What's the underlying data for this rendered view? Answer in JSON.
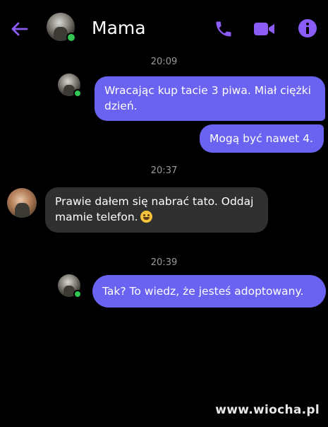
{
  "header": {
    "contact_name": "Mama",
    "icons": [
      "back-arrow-icon",
      "phone-icon",
      "video-camera-icon",
      "info-icon"
    ],
    "accent_color": "#8b5cf6",
    "online_color": "#31c554"
  },
  "messages": [
    {
      "type": "timestamp",
      "text": "20:09"
    },
    {
      "type": "outgoing",
      "lines": [
        "Wracając kup tacie 3 piwa. Miał ciężki",
        "dzień."
      ]
    },
    {
      "type": "outgoing",
      "text": "Mogą być nawet 4."
    },
    {
      "type": "timestamp",
      "text": "20:37"
    },
    {
      "type": "incoming",
      "lines": [
        "Prawie dałem się nabrać tato. Oddaj",
        "mamie telefon."
      ],
      "emoji": "smiling-face-with-sweat-emoji"
    },
    {
      "type": "timestamp",
      "text": "20:39"
    },
    {
      "type": "outgoing",
      "text": "Tak? To wiedz, że jesteś adoptowany."
    }
  ],
  "colors": {
    "outgoing_bubble": "#6a63f1",
    "incoming_bubble": "#303030",
    "background": "#000000"
  },
  "watermark": "www.wiocha.pl"
}
